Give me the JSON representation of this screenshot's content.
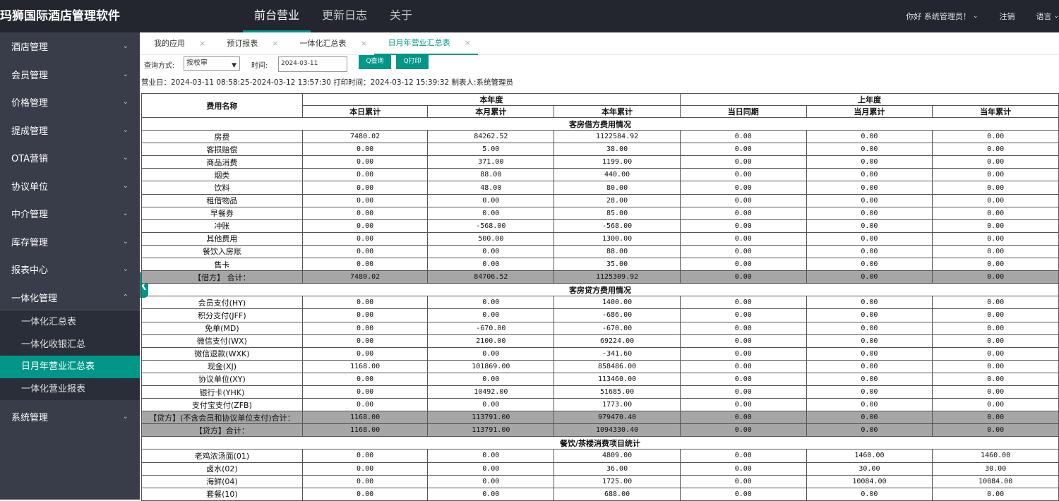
{
  "app": {
    "title": "玛狮国际酒店管理软件"
  },
  "topnav": [
    {
      "label": "前台营业",
      "active": true
    },
    {
      "label": "更新日志",
      "active": false
    },
    {
      "label": "关于",
      "active": false
    }
  ],
  "topright": {
    "greeting": "你好 系统管理员！",
    "logout": "注销",
    "language": "语言"
  },
  "sidebar": {
    "items": [
      {
        "label": "酒店管理"
      },
      {
        "label": "会员管理"
      },
      {
        "label": "价格管理"
      },
      {
        "label": "提成管理"
      },
      {
        "label": "OTA营销"
      },
      {
        "label": "协议单位"
      },
      {
        "label": "中介管理"
      },
      {
        "label": "库存管理"
      },
      {
        "label": "报表中心"
      },
      {
        "label": "一体化管理"
      }
    ],
    "subitems": [
      {
        "label": "一体化汇总表"
      },
      {
        "label": "一体化收银汇总"
      },
      {
        "label": "日月年营业汇总表",
        "active": true
      },
      {
        "label": "一体化营业报表"
      }
    ],
    "after": [
      {
        "label": "系统管理"
      }
    ]
  },
  "tabs": [
    {
      "label": "我的应用"
    },
    {
      "label": "预订报表"
    },
    {
      "label": "一体化汇总表"
    },
    {
      "label": "日月年营业汇总表",
      "active": true
    }
  ],
  "query": {
    "mode_label": "查询方式:",
    "mode_value": "按校审",
    "time_label": "时间:",
    "time_value": "2024-03-11",
    "query_button": "Q查询",
    "print_button": "Q打印"
  },
  "info": "营业日：2024-03-11 08:58:25-2024-03-12 13:57:30 打印时间：2024-03-12 15:39:32 制表人:系统管理员",
  "report": {
    "col_name": "费用名称",
    "group_this_year": "本年度",
    "group_last_year": "上年度",
    "columns": [
      "本日累计",
      "本月累计",
      "本年累计",
      "当日同期",
      "当月累计",
      "当年累计"
    ],
    "sections": [
      {
        "title": "客房借方费用情况",
        "rows": [
          {
            "name": "房费",
            "values": [
              "7480.02",
              "84262.52",
              "1122584.92",
              "0.00",
              "0.00",
              "0.00"
            ]
          },
          {
            "name": "客损赔偿",
            "values": [
              "0.00",
              "5.00",
              "38.00",
              "0.00",
              "0.00",
              "0.00"
            ]
          },
          {
            "name": "商品消费",
            "values": [
              "0.00",
              "371.00",
              "1199.00",
              "0.00",
              "0.00",
              "0.00"
            ]
          },
          {
            "name": "烟类",
            "values": [
              "0.00",
              "88.00",
              "440.00",
              "0.00",
              "0.00",
              "0.00"
            ]
          },
          {
            "name": "饮料",
            "values": [
              "0.00",
              "48.00",
              "80.00",
              "0.00",
              "0.00",
              "0.00"
            ]
          },
          {
            "name": "租借物品",
            "values": [
              "0.00",
              "0.00",
              "28.00",
              "0.00",
              "0.00",
              "0.00"
            ]
          },
          {
            "name": "早餐券",
            "values": [
              "0.00",
              "0.00",
              "85.00",
              "0.00",
              "0.00",
              "0.00"
            ]
          },
          {
            "name": "冲账",
            "values": [
              "0.00",
              "-568.00",
              "-568.00",
              "0.00",
              "0.00",
              "0.00"
            ]
          },
          {
            "name": "其他费用",
            "values": [
              "0.00",
              "500.00",
              "1300.00",
              "0.00",
              "0.00",
              "0.00"
            ]
          },
          {
            "name": "餐饮入房账",
            "values": [
              "0.00",
              "0.00",
              "88.00",
              "0.00",
              "0.00",
              "0.00"
            ]
          },
          {
            "name": "售卡",
            "values": [
              "0.00",
              "0.00",
              "35.00",
              "0.00",
              "0.00",
              "0.00"
            ]
          },
          {
            "name": "【借方】 合计：",
            "values": [
              "7480.02",
              "84706.52",
              "1125309.92",
              "0.00",
              "0.00",
              "0.00"
            ],
            "total": true
          }
        ]
      },
      {
        "title": "客房贷方费用情况",
        "rows": [
          {
            "name": "会员支付(HY)",
            "values": [
              "0.00",
              "0.00",
              "1400.00",
              "0.00",
              "0.00",
              "0.00"
            ]
          },
          {
            "name": "积分支付(JFF)",
            "values": [
              "0.00",
              "0.00",
              "-686.00",
              "0.00",
              "0.00",
              "0.00"
            ]
          },
          {
            "name": "免单(MD)",
            "values": [
              "0.00",
              "-670.00",
              "-670.00",
              "0.00",
              "0.00",
              "0.00"
            ]
          },
          {
            "name": "微信支付(WX)",
            "values": [
              "0.00",
              "2100.00",
              "69224.00",
              "0.00",
              "0.00",
              "0.00"
            ]
          },
          {
            "name": "微信退款(WXK)",
            "values": [
              "0.00",
              "0.00",
              "-341.60",
              "0.00",
              "0.00",
              "0.00"
            ]
          },
          {
            "name": "现金(XJ)",
            "values": [
              "1168.00",
              "101869.00",
              "858486.00",
              "0.00",
              "0.00",
              "0.00"
            ]
          },
          {
            "name": "协议单位(XY)",
            "values": [
              "0.00",
              "0.00",
              "113460.00",
              "0.00",
              "0.00",
              "0.00"
            ]
          },
          {
            "name": "银行卡(YHK)",
            "values": [
              "0.00",
              "10492.00",
              "51685.00",
              "0.00",
              "0.00",
              "0.00"
            ]
          },
          {
            "name": "支付宝支付(ZFB)",
            "values": [
              "0.00",
              "0.00",
              "1773.00",
              "0.00",
              "0.00",
              "0.00"
            ]
          },
          {
            "name": "【贷方】(不含会员和协议单位支付)合计：",
            "values": [
              "1168.00",
              "113791.00",
              "979470.40",
              "0.00",
              "0.00",
              "0.00"
            ],
            "total": true
          },
          {
            "name": "【贷方】合计：",
            "values": [
              "1168.00",
              "113791.00",
              "1094330.40",
              "0.00",
              "0.00",
              "0.00"
            ],
            "total": true
          }
        ]
      },
      {
        "title": "餐饮/茶楼消费项目统计",
        "rows": [
          {
            "name": "老鸡浓汤面(01)",
            "values": [
              "0.00",
              "0.00",
              "4809.00",
              "0.00",
              "1460.00",
              "1460.00"
            ]
          },
          {
            "name": "卤水(02)",
            "values": [
              "0.00",
              "0.00",
              "36.00",
              "0.00",
              "30.00",
              "30.00"
            ]
          },
          {
            "name": "海鲜(04)",
            "values": [
              "0.00",
              "0.00",
              "1725.00",
              "0.00",
              "10084.00",
              "10084.00"
            ]
          },
          {
            "name": "套餐(10)",
            "values": [
              "0.00",
              "0.00",
              "688.00",
              "0.00",
              "0.00",
              "0.00"
            ]
          }
        ]
      }
    ]
  }
}
